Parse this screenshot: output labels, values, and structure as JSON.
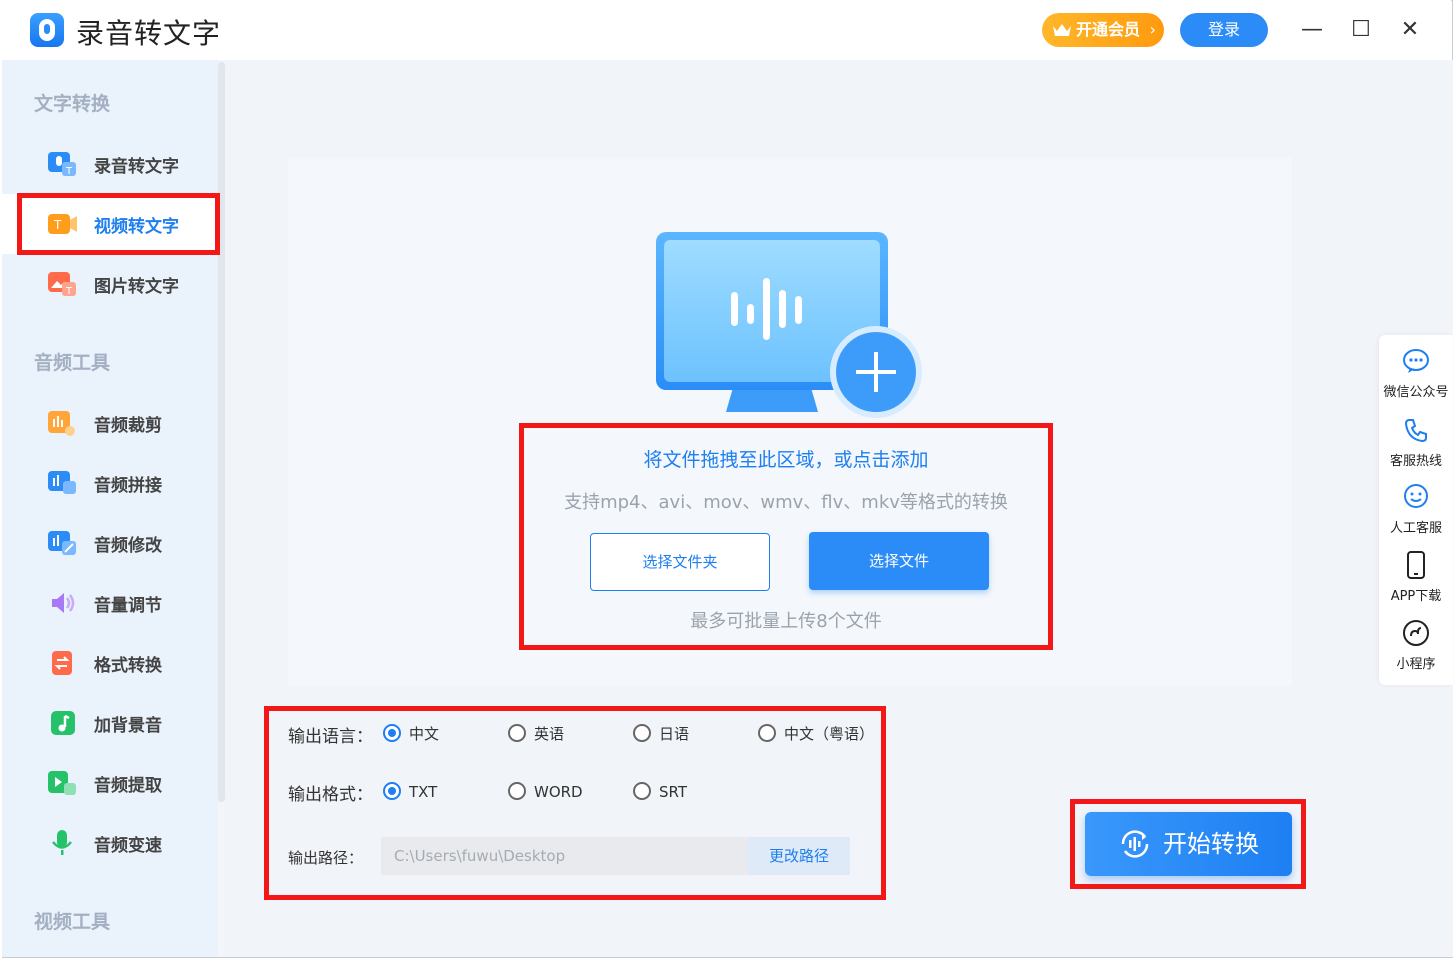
{
  "app": {
    "title": "录音转文字"
  },
  "titlebar": {
    "vip_label": "开通会员",
    "vip_arrow": "›",
    "login_label": "登录",
    "minimize": "—",
    "maximize": "☐",
    "close": "✕"
  },
  "sidebar": {
    "sections": [
      {
        "title": "文字转换"
      },
      {
        "title": "音频工具"
      },
      {
        "title": "视频工具"
      }
    ],
    "items": [
      {
        "label": "录音转文字",
        "icon": "voice-to-text-icon"
      },
      {
        "label": "视频转文字",
        "icon": "video-to-text-icon",
        "active": true
      },
      {
        "label": "图片转文字",
        "icon": "image-to-text-icon"
      },
      {
        "label": "音频裁剪",
        "icon": "audio-cut-icon"
      },
      {
        "label": "音频拼接",
        "icon": "audio-merge-icon"
      },
      {
        "label": "音频修改",
        "icon": "audio-edit-icon"
      },
      {
        "label": "音量调节",
        "icon": "volume-icon"
      },
      {
        "label": "格式转换",
        "icon": "format-convert-icon"
      },
      {
        "label": "加背景音",
        "icon": "music-note-icon"
      },
      {
        "label": "音频提取",
        "icon": "audio-extract-icon"
      },
      {
        "label": "音频变速",
        "icon": "speed-mic-icon"
      }
    ]
  },
  "dropzone": {
    "title": "将文件拖拽至此区域，或点击添加",
    "subtitle": "支持mp4、avi、mov、wmv、flv、mkv等格式的转换",
    "select_folder": "选择文件夹",
    "select_file": "选择文件",
    "hint": "最多可批量上传8个文件"
  },
  "options": {
    "language_label": "输出语言：",
    "languages": [
      "中文",
      "英语",
      "日语",
      "中文（粤语）"
    ],
    "language_selected": "中文",
    "format_label": "输出格式：",
    "formats": [
      "TXT",
      "WORD",
      "SRT"
    ],
    "format_selected": "TXT",
    "path_label": "输出路径：",
    "path_value": "C:\\Users\\fuwu\\Desktop",
    "path_button": "更改路径"
  },
  "start_button": "开始转换",
  "float_panel": [
    {
      "label": "微信公众号",
      "icon": "wechat-icon"
    },
    {
      "label": "客服热线",
      "icon": "phone-icon"
    },
    {
      "label": "人工客服",
      "icon": "service-icon"
    },
    {
      "label": "APP下载",
      "icon": "mobile-icon"
    },
    {
      "label": "小程序",
      "icon": "mini-program-icon"
    }
  ],
  "colors": {
    "accent": "#1e7ff0",
    "highlight": "#f21818",
    "vip": "#ffa51a",
    "sidebar_bg": "#eaf2fc"
  }
}
